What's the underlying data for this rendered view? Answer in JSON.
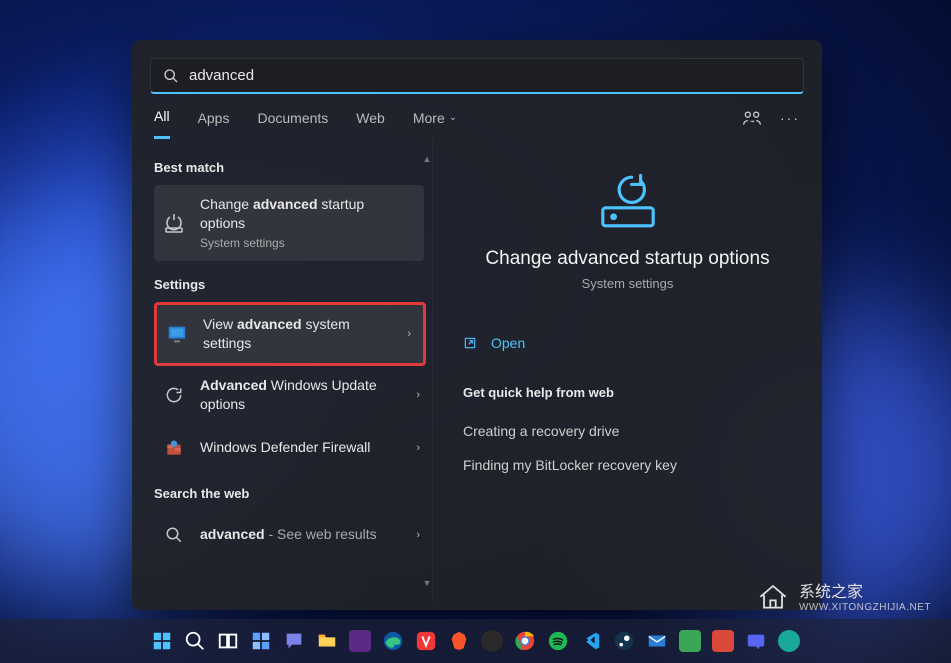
{
  "search": {
    "query": "advanced"
  },
  "tabs": {
    "all": "All",
    "apps": "Apps",
    "documents": "Documents",
    "web": "Web",
    "more": "More"
  },
  "sections": {
    "best_match": "Best match",
    "settings": "Settings",
    "search_web": "Search the web"
  },
  "results": {
    "best_match": {
      "title_pre": "Change ",
      "title_bold": "advanced",
      "title_post": " startup options",
      "sub": "System settings"
    },
    "settings": [
      {
        "pre": "View ",
        "bold": "advanced",
        "post": " system settings",
        "sub": ""
      },
      {
        "pre": "",
        "bold": "Advanced",
        "post": " Windows Update options",
        "sub": ""
      },
      {
        "pre": "",
        "bold": "",
        "post": "Windows Defender Firewall",
        "sub": ""
      }
    ],
    "web": {
      "bold": "advanced",
      "post": " - See web results"
    }
  },
  "preview": {
    "title": "Change advanced startup options",
    "sub": "System settings",
    "open": "Open",
    "help_head": "Get quick help from web",
    "help_links": [
      "Creating a recovery drive",
      "Finding my BitLocker recovery key"
    ]
  },
  "watermark": {
    "cn": "系统之家",
    "url": "WWW.XITONGZHIJIA.NET"
  }
}
